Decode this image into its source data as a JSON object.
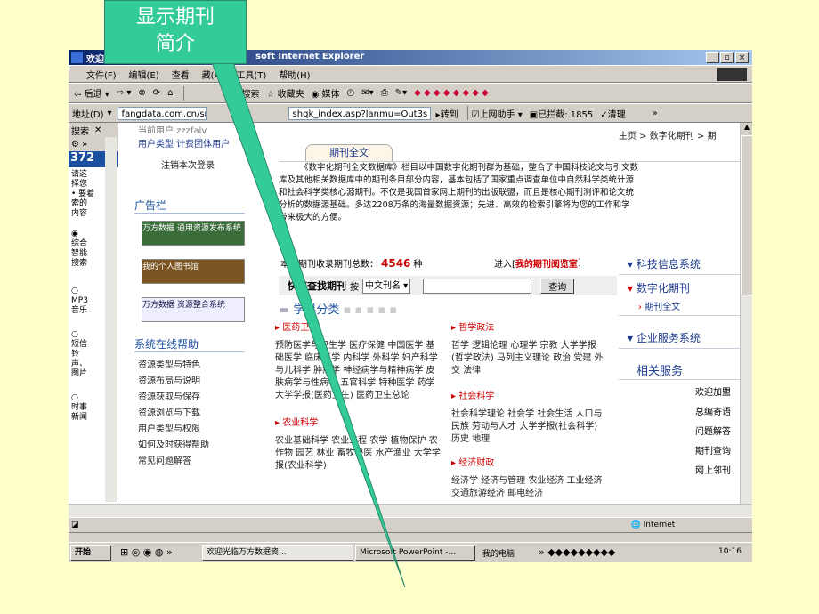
{
  "callout": {
    "line1": "显示期刊",
    "line2": "简介"
  },
  "window": {
    "title_left": "欢迎",
    "title_right": "soft Internet Explorer",
    "min": "_",
    "max": "▫",
    "close": "×"
  },
  "menu": {
    "file": "文件(F)",
    "edit": "编辑(E)",
    "view": "查看",
    "favorites": "藏(A)",
    "tools": "工具(T)",
    "help": "帮助(H)"
  },
  "toolbar": {
    "back": "后退",
    "search": "搜索",
    "favorites": "收藏夹",
    "media": "媒体"
  },
  "address": {
    "label": "地址(D)",
    "url_left": "fangdata.com.cn/src/sywj",
    "url_right": "shqk_index.asp?lanmu=Out3s",
    "go": "转到",
    "helper": "上网助手",
    "blocked": "已拦截: 1855",
    "clean": "清理"
  },
  "search_pane": {
    "title": "搜索",
    "tab": "372",
    "lines": [
      "请这",
      "择您",
      "要着",
      "索的",
      "内容"
    ],
    "opt1": [
      "综合",
      "智能",
      "搜索"
    ],
    "opt2": [
      "MP3",
      "音乐"
    ],
    "opt3": [
      "短信",
      "铃",
      "声、",
      "图片"
    ],
    "opt4": [
      "时事",
      "新闻"
    ]
  },
  "left_nav": {
    "top_cut": "当前用户 zzzfaly",
    "user_types": "用户类型 计费团体用户",
    "logout": "注销本次登录",
    "ad_title": "广告栏",
    "ad1": "万方数据 通用资源发布系统",
    "ad2": "我的个人图书馆",
    "ad3": "万方数据 资源整合系统",
    "help_title": "系统在线帮助",
    "help_items": [
      "资源类型与特色",
      "资源布局与说明",
      "资源获取与保存",
      "资源浏览与下载",
      "用户类型与权限",
      "如何及时获得帮助",
      "常见问题解答"
    ]
  },
  "main": {
    "breadcrumb": "主页 > 数字化期刊 > 期",
    "intro_tab": "期刊全文",
    "intro": [
      "《数字化期刊全文数据库》栏目以中国数字化期刊群为基础，整合了中国科技论文与引文数",
      "库及其他相关数据库中的期刊条目部分内容，基本包括了国家重点调查单位中自然科学类统计源",
      "和社会科学类核心源期刊。不仅是我国首家网上期刊的出版联盟，而且是核心期刊测评和论文统",
      "分析的数据源基础。多达2208万条的海量数据资源；先进、高效的检索引擎将为您的工作和学",
      "带来极大的方便。"
    ],
    "total_label": "本站期刊收录期刊总数：",
    "total_value": "4546",
    "total_unit": "种",
    "reading_room_pre": "进入[",
    "reading_room": "我的期刊阅览室",
    "reading_room_post": "]",
    "quick_label": "快速查找期刊",
    "by": "按",
    "select_value": "中文刊名",
    "search_btn": "查询",
    "subject_title": "学科分类",
    "cat1": "医药卫生",
    "cat1_text": "预防医学与卫生学 医疗保健 中国医学 基础医学 临床医学 内科学 外科学 妇产科学与儿科学 肿瘤学 神经病学与精神病学 皮肤病学与性病学 五官科学 特种医学 药学 大学学报(医药卫生) 医药卫生总论",
    "cat2": "哲学政法",
    "cat2_text": "哲学 逻辑伦理 心理学 宗教 大学学报(哲学政法) 马列主义理论 政治 党建 外交 法律",
    "cat3": "社会科学",
    "cat3_text": "社会科学理论 社会学 社会生活 人口与民族 劳动与人才 大学学报(社会科学) 历史 地理",
    "cat4": "农业科学",
    "cat4_text": "农业基础科学 农业工程 农学 植物保护 农作物 园艺 林业 畜牧兽医 水产渔业 大学学报(农业科学)",
    "cat5": "经济财政",
    "cat5_text": "经济学 经济与管理 农业经济 工业经济 交通旅游经济 邮电经济"
  },
  "right_nav": {
    "sys1": "科技信息系统",
    "sys2": "数字化期刊",
    "sys2_sub": "期刊全文",
    "sys3": "企业服务系统",
    "related": "相关服务",
    "links": [
      "欢迎加盟",
      "总编寄语",
      "问题解答",
      "期刊查询",
      "网上邻刊"
    ]
  },
  "status": {
    "zone": "Internet"
  },
  "taskbar": {
    "start": "开始",
    "task1": "欢迎光临万方数据资...",
    "task2": "Microsoft PowerPoint -...",
    "mypc": "我的电脑",
    "time": "10:16"
  },
  "colors": {
    "accent": "#1c3b8c",
    "callout": "#33cc99",
    "red": "#cc0000"
  }
}
